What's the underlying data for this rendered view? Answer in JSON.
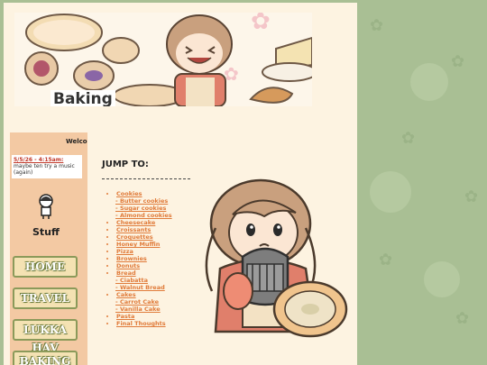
{
  "banner": {
    "title": "Baking"
  },
  "sidebar": {
    "marquee_text": "Welcome",
    "status": {
      "date": "5/5/26 - 4:15am:",
      "text": "maybe ten try a music (again)"
    },
    "stuff_label": "Stuff",
    "nav_buttons": [
      "HOME",
      "TRAVEL",
      "LUKKA HAV",
      "BAKING"
    ]
  },
  "jump_to": {
    "title": "JUMP TO:",
    "items": [
      {
        "label": "Cookies",
        "sub": false
      },
      {
        "label": "- Butter cookies",
        "sub": true
      },
      {
        "label": "- Sugar cookies",
        "sub": true
      },
      {
        "label": "- Almond cookies",
        "sub": true
      },
      {
        "label": "Cheesecake",
        "sub": false
      },
      {
        "label": "Croissants",
        "sub": false
      },
      {
        "label": "Croquettes",
        "sub": false
      },
      {
        "label": "Honey Muffin",
        "sub": false
      },
      {
        "label": "Pizza",
        "sub": false
      },
      {
        "label": "Brownies",
        "sub": false
      },
      {
        "label": "Donuts",
        "sub": false
      },
      {
        "label": "Bread",
        "sub": false
      },
      {
        "label": "- Ciabatta",
        "sub": true
      },
      {
        "label": "- Walnut Bread",
        "sub": true
      },
      {
        "label": "Cakes",
        "sub": false
      },
      {
        "label": "- Carrot Cake",
        "sub": true
      },
      {
        "label": "- Vanilla Cake",
        "sub": true
      },
      {
        "label": "Pasta",
        "sub": false
      },
      {
        "label": "Final Thoughts",
        "sub": false
      }
    ]
  }
}
